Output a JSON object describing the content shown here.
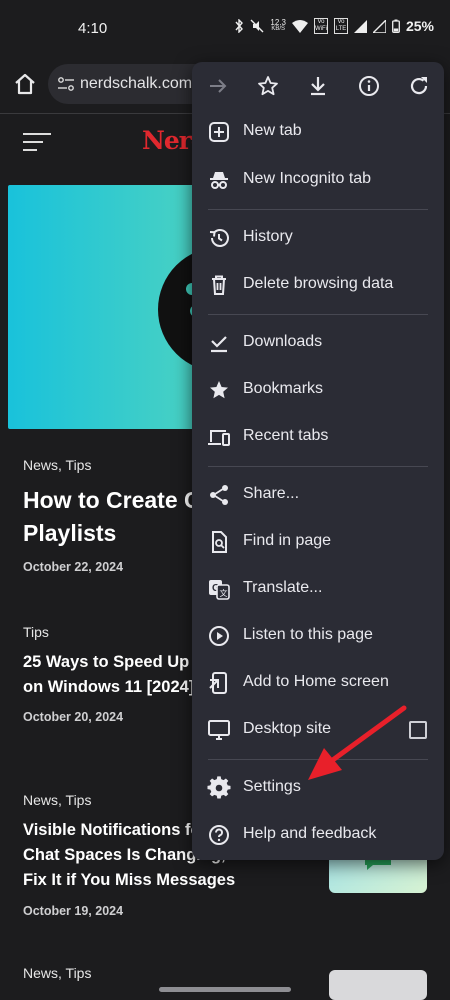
{
  "status_bar": {
    "time": "4:10",
    "net_speed_value": "12.3",
    "net_speed_unit": "KB/S",
    "sim1_label": "Vo WiFi",
    "sim2_label": "Vo LTE",
    "battery": "25%"
  },
  "toolbar": {
    "url": "nerdschalk.com",
    "home_icon": "home-icon",
    "site_info_icon": "tune-icon"
  },
  "site": {
    "logo_text": "Nerd"
  },
  "articles": [
    {
      "categories": "News, Tips",
      "title_line1": "How to Create Co",
      "title_line2": "Playlists",
      "date": "October 22, 2024"
    },
    {
      "categories": "Tips",
      "title_line1": "25 Ways to Speed Up Yo",
      "title_line2": "on Windows 11 [2024]",
      "date": "October 20, 2024"
    },
    {
      "categories": "News, Tips",
      "title_line1": "Visible Notifications for",
      "title_line2": "Chat Spaces Is Changing,",
      "title_line3": "Fix It if You Miss Messages",
      "date": "October 19, 2024"
    },
    {
      "categories": "News, Tips"
    }
  ],
  "menu": {
    "top_icons": [
      "forward-arrow-icon",
      "star-icon",
      "download-icon",
      "info-icon",
      "refresh-icon"
    ],
    "items": [
      {
        "label": "New tab",
        "icon": "plus-box-icon"
      },
      {
        "label": "New Incognito tab",
        "icon": "incognito-icon"
      },
      {
        "label": "History",
        "icon": "history-icon"
      },
      {
        "label": "Delete browsing data",
        "icon": "trash-icon"
      },
      {
        "label": "Downloads",
        "icon": "downloads-check-icon"
      },
      {
        "label": "Bookmarks",
        "icon": "star-filled-icon"
      },
      {
        "label": "Recent tabs",
        "icon": "devices-icon"
      },
      {
        "label": "Share...",
        "icon": "share-icon"
      },
      {
        "label": "Find in page",
        "icon": "find-in-page-icon"
      },
      {
        "label": "Translate...",
        "icon": "translate-icon"
      },
      {
        "label": "Listen to this page",
        "icon": "play-circle-icon"
      },
      {
        "label": "Add to Home screen",
        "icon": "add-to-home-icon"
      },
      {
        "label": "Desktop site",
        "icon": "monitor-icon",
        "checked": false
      },
      {
        "label": "Settings",
        "icon": "gear-icon"
      },
      {
        "label": "Help and feedback",
        "icon": "help-icon"
      }
    ]
  },
  "colors": {
    "background": "#1c1c1e",
    "menu_bg": "#2b2c35",
    "logo_red": "#e0282e",
    "annotation_red": "#e8202a"
  }
}
